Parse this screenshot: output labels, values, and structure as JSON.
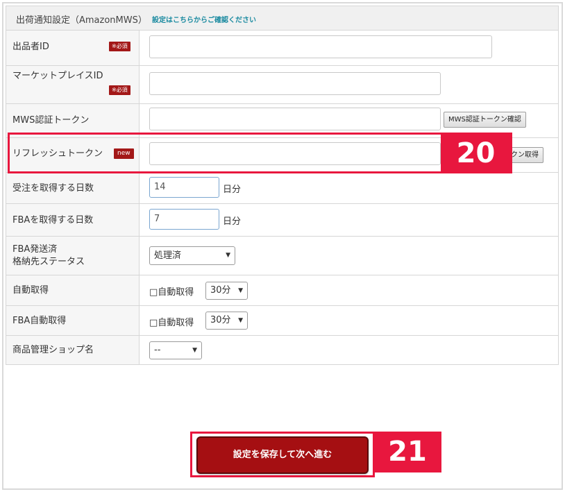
{
  "header": {
    "title": "出荷通知設定（AmazonMWS）",
    "link": "設定はこちらからご確認ください"
  },
  "required_badge": "※必須",
  "new_badge": "new",
  "rows": {
    "seller_id": {
      "label": "出品者ID",
      "value": ""
    },
    "marketplace_id": {
      "label": "マーケットプレイスID",
      "value": ""
    },
    "mws_token": {
      "label": "MWS認証トークン",
      "value": "",
      "button": "MWS認証トークン確認"
    },
    "refresh_token": {
      "label": "リフレッシュトークン",
      "value": "",
      "button": "トークン取得",
      "button_visible": "クン取得"
    },
    "order_days": {
      "label": "受注を取得する日数",
      "value": "14",
      "unit": "日分"
    },
    "fba_days": {
      "label": "FBAを取得する日数",
      "value": "7",
      "unit": "日分"
    },
    "fba_status": {
      "label_line1": "FBA発送済",
      "label_line2": "格納先ステータス",
      "selected": "処理済"
    },
    "auto_fetch": {
      "label": "自動取得",
      "checkbox": "□自動取得",
      "interval": "30分"
    },
    "fba_auto_fetch": {
      "label": "FBA自動取得",
      "checkbox": "□自動取得",
      "interval": "30分"
    },
    "shop_name": {
      "label": "商品管理ショップ名",
      "selected": "--"
    }
  },
  "save_button": "設定を保存して次へ進む",
  "callouts": {
    "c20": "20",
    "c21": "21"
  },
  "colors": {
    "accent": "#e8173e",
    "save": "#a50f12",
    "badge": "#a31818"
  }
}
